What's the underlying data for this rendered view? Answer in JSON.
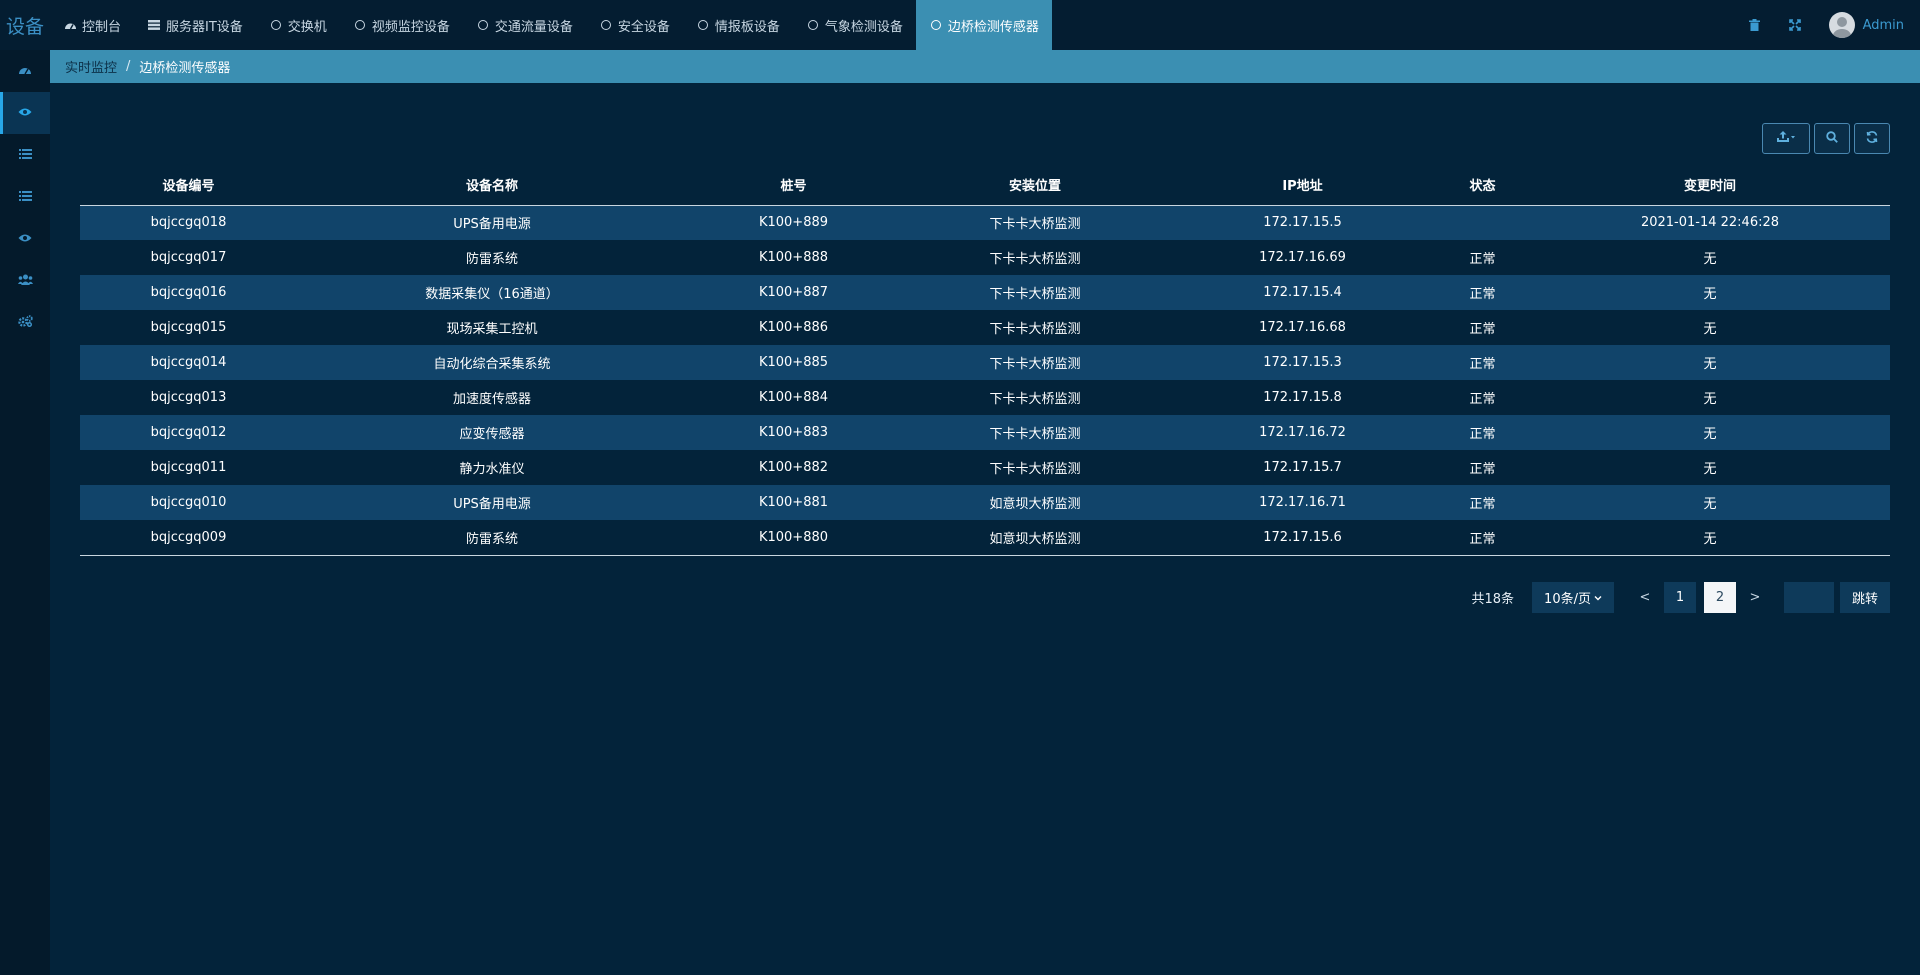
{
  "brand": "设备",
  "tabs": [
    {
      "label": "控制台",
      "icon": "dashboard-icon"
    },
    {
      "label": "服务器IT设备",
      "icon": "server-icon"
    },
    {
      "label": "交换机",
      "icon": "circle-icon"
    },
    {
      "label": "视频监控设备",
      "icon": "circle-icon"
    },
    {
      "label": "交通流量设备",
      "icon": "circle-icon"
    },
    {
      "label": "安全设备",
      "icon": "circle-icon"
    },
    {
      "label": "情报板设备",
      "icon": "circle-icon"
    },
    {
      "label": "气象检测设备",
      "icon": "circle-icon"
    },
    {
      "label": "边桥检测传感器",
      "icon": "circle-icon",
      "active": true
    }
  ],
  "user": {
    "name": "Admin"
  },
  "breadcrumb": {
    "root": "实时监控",
    "separator": "/",
    "current": "边桥检测传感器"
  },
  "table": {
    "columns": [
      "设备编号",
      "设备名称",
      "桩号",
      "安装位置",
      "IP地址",
      "状态",
      "变更时间"
    ],
    "rows": [
      [
        "bqjccgq018",
        "UPS备用电源",
        "K100+889",
        "下卡卡大桥监测",
        "172.17.15.5",
        "",
        "2021-01-14 22:46:28"
      ],
      [
        "bqjccgq017",
        "防雷系统",
        "K100+888",
        "下卡卡大桥监测",
        "172.17.16.69",
        "正常",
        "无"
      ],
      [
        "bqjccgq016",
        "数据采集仪（16通道）",
        "K100+887",
        "下卡卡大桥监测",
        "172.17.15.4",
        "正常",
        "无"
      ],
      [
        "bqjccgq015",
        "现场采集工控机",
        "K100+886",
        "下卡卡大桥监测",
        "172.17.16.68",
        "正常",
        "无"
      ],
      [
        "bqjccgq014",
        "自动化综合采集系统",
        "K100+885",
        "下卡卡大桥监测",
        "172.17.15.3",
        "正常",
        "无"
      ],
      [
        "bqjccgq013",
        "加速度传感器",
        "K100+884",
        "下卡卡大桥监测",
        "172.17.15.8",
        "正常",
        "无"
      ],
      [
        "bqjccgq012",
        "应变传感器",
        "K100+883",
        "下卡卡大桥监测",
        "172.17.16.72",
        "正常",
        "无"
      ],
      [
        "bqjccgq011",
        "静力水准仪",
        "K100+882",
        "下卡卡大桥监测",
        "172.17.15.7",
        "正常",
        "无"
      ],
      [
        "bqjccgq010",
        "UPS备用电源",
        "K100+881",
        "如意坝大桥监测",
        "172.17.16.71",
        "正常",
        "无"
      ],
      [
        "bqjccgq009",
        "防雷系统",
        "K100+880",
        "如意坝大桥监测",
        "172.17.15.6",
        "正常",
        "无"
      ]
    ]
  },
  "pagination": {
    "total": "共18条",
    "page_size": "10条/页",
    "prev": "<",
    "next": ">",
    "pages": [
      "1",
      "2"
    ],
    "current": "2",
    "jump": "跳转"
  },
  "colors": {
    "accent": "#3b8fb2",
    "background": "#03233a",
    "row_alt": "#11446a"
  }
}
